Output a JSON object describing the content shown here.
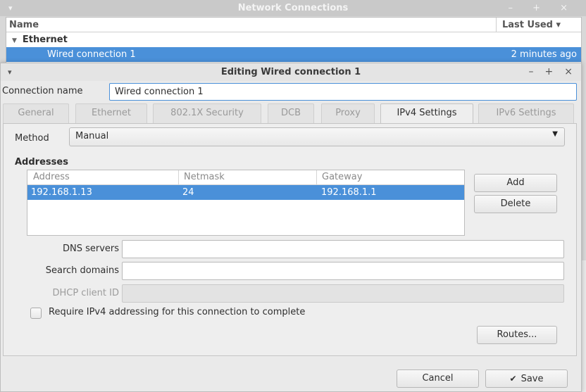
{
  "bg_window": {
    "title": "Network Connections",
    "menu_glyph": "▾",
    "controls": "– + ×",
    "columns": {
      "name": "Name",
      "last_used": "Last Used ▾"
    },
    "group": "Ethernet",
    "rows": [
      {
        "name": "Wired connection 1",
        "last_used": "2 minutes ago"
      }
    ]
  },
  "dialog": {
    "title": "Editing Wired connection 1",
    "connection_name_label": "Connection name",
    "connection_name_value": "Wired connection 1",
    "tabs": [
      "General",
      "Ethernet",
      "802.1X Security",
      "DCB",
      "Proxy",
      "IPv4 Settings",
      "IPv6 Settings"
    ],
    "active_tab": "IPv4 Settings",
    "method_label": "Method",
    "method_value": "Manual",
    "addresses_title": "Addresses",
    "address_columns": [
      "Address",
      "Netmask",
      "Gateway"
    ],
    "address_rows": [
      {
        "address": "192.168.1.13",
        "netmask": "24",
        "gateway": "192.168.1.1"
      }
    ],
    "add_label": "Add",
    "delete_label": "Delete",
    "dns_label": "DNS servers",
    "dns_value": "",
    "search_label": "Search domains",
    "search_value": "",
    "dhcp_label": "DHCP client ID",
    "dhcp_value": "",
    "require_label": "Require IPv4 addressing for this connection to complete",
    "routes_label": "Routes...",
    "cancel_label": "Cancel",
    "save_label": "Save"
  },
  "colors": {
    "selection": "#4a90d9",
    "focus_border": "#4a90d9"
  }
}
